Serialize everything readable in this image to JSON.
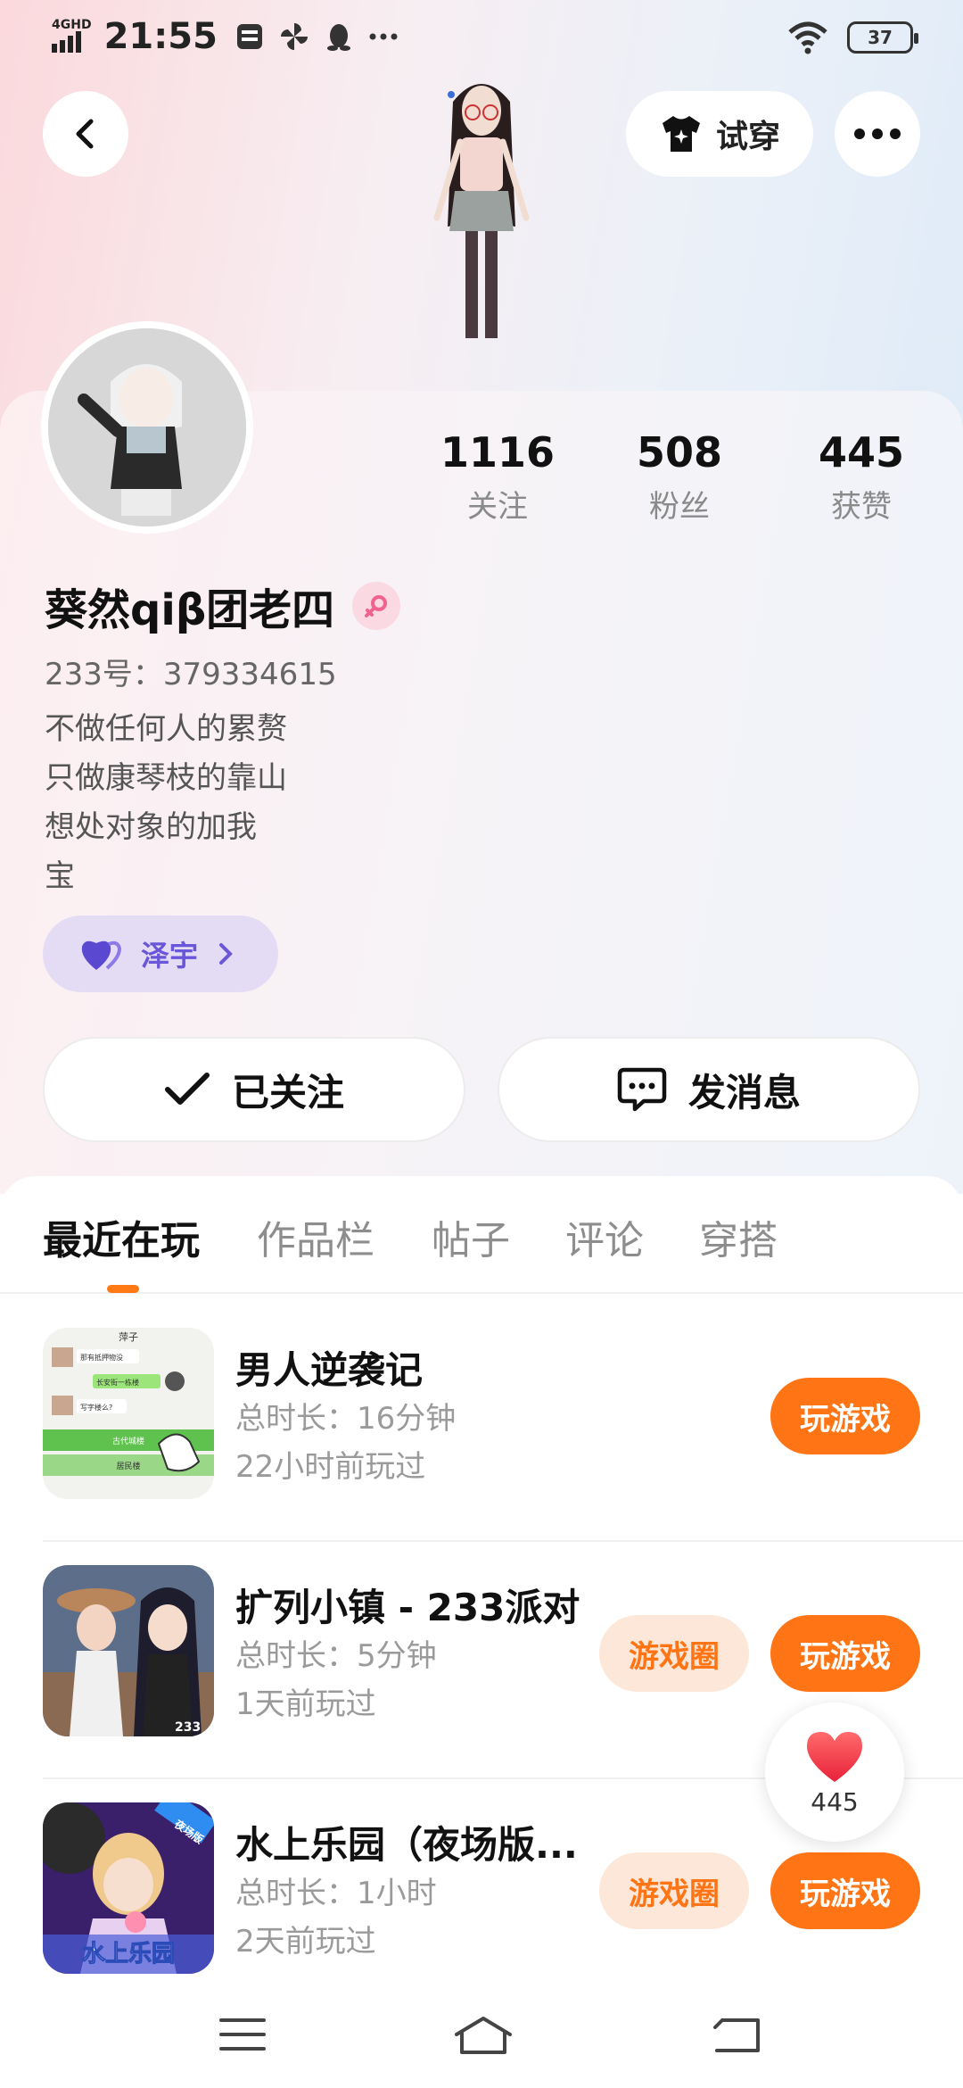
{
  "status_bar": {
    "network": "4GHD",
    "time": "21:55",
    "battery": "37"
  },
  "header": {
    "tryon_label": "试穿"
  },
  "profile": {
    "stats": [
      {
        "value": "1116",
        "label": "关注"
      },
      {
        "value": "508",
        "label": "粉丝"
      },
      {
        "value": "445",
        "label": "获赞"
      }
    ],
    "username": "葵然qiβ团老四",
    "uid": "233号：379334615",
    "bio": [
      "不做任何人的累赘",
      "只做康琴枝的靠山",
      "想处对象的加我",
      "宝"
    ],
    "cp_name": "泽宇",
    "follow_label": "已关注",
    "message_label": "发消息"
  },
  "tabs": [
    "最近在玩",
    "作品栏",
    "帖子",
    "评论",
    "穿搭"
  ],
  "games": [
    {
      "title": "男人逆袭记",
      "duration": "总时长：16分钟",
      "last_played": "22小时前玩过",
      "play_label": "玩游戏",
      "circle_label": null
    },
    {
      "title": "扩列小镇 - 233派对",
      "duration": "总时长：5分钟",
      "last_played": "1天前玩过",
      "play_label": "玩游戏",
      "circle_label": "游戏圈"
    },
    {
      "title": "水上乐园（夜场版...",
      "duration": "总时长：1小时",
      "last_played": "2天前玩过",
      "play_label": "玩游戏",
      "circle_label": "游戏圈"
    }
  ],
  "game1_icon_text": {
    "header": "萍子",
    "b1": "那有抵押物没",
    "b2": "长安街一栋楼",
    "b3": "写字楼么?",
    "opt1": "古代城楼",
    "opt2": "居民楼"
  },
  "game2_icon_text": "233",
  "game3_icon_text": {
    "badge": "夜场版",
    "title": "水上乐园"
  },
  "like_float": {
    "count": "445"
  },
  "colors": {
    "accent": "#ff7414",
    "accent_soft": "#fde7d8",
    "cp_purple": "#6a56d8"
  }
}
